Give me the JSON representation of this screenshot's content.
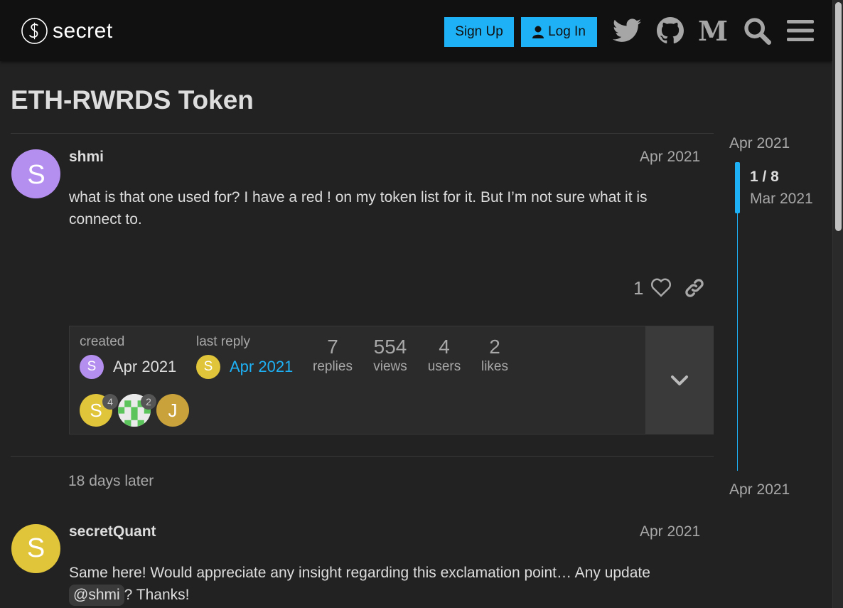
{
  "header": {
    "logo_text": "secret",
    "signup_label": "Sign Up",
    "login_label": "Log In",
    "icons": [
      "twitter-icon",
      "github-icon",
      "medium-icon",
      "search-icon",
      "hamburger-menu-icon"
    ],
    "medium_letter": "M"
  },
  "topic": {
    "title": "ETH-RWRDS Token"
  },
  "posts": [
    {
      "username": "shmi",
      "avatar_letter": "S",
      "avatar_color": "#b58ff0",
      "date": "Apr 2021",
      "body": "what is that one used for? I have a red ! on my token list for it. But I’m not sure what it is connect to.",
      "like_count": "1"
    },
    {
      "username": "secretQuant",
      "avatar_letter": "S",
      "avatar_color": "#e0c53a",
      "date": "Apr 2021",
      "body_prefix": "Same here! Would appreciate any insight regarding this exclamation point… Any update",
      "mention": "@shmi",
      "body_suffix": "? Thanks!"
    }
  ],
  "topic_map": {
    "created_label": "created",
    "created_date": "Apr 2021",
    "last_reply_label": "last reply",
    "last_reply_date": "Apr 2021",
    "stats": [
      {
        "value": "7",
        "label": "replies"
      },
      {
        "value": "554",
        "label": "views"
      },
      {
        "value": "4",
        "label": "users"
      },
      {
        "value": "2",
        "label": "likes"
      }
    ],
    "posters": [
      {
        "letter": "S",
        "color": "#e0c53a",
        "count": "4"
      },
      {
        "letter": "",
        "color": "#eaeaea",
        "count": "2"
      },
      {
        "letter": "J",
        "color": "#c9a23c",
        "count": ""
      }
    ]
  },
  "small_action": "18 days later",
  "timeline": {
    "start_date": "Apr 2021",
    "position": "1 / 8",
    "current_date": "Mar 2021",
    "end_date": "Apr 2021"
  },
  "colors": {
    "accent": "#1eb1f5",
    "background": "#222222",
    "header": "#111111"
  }
}
